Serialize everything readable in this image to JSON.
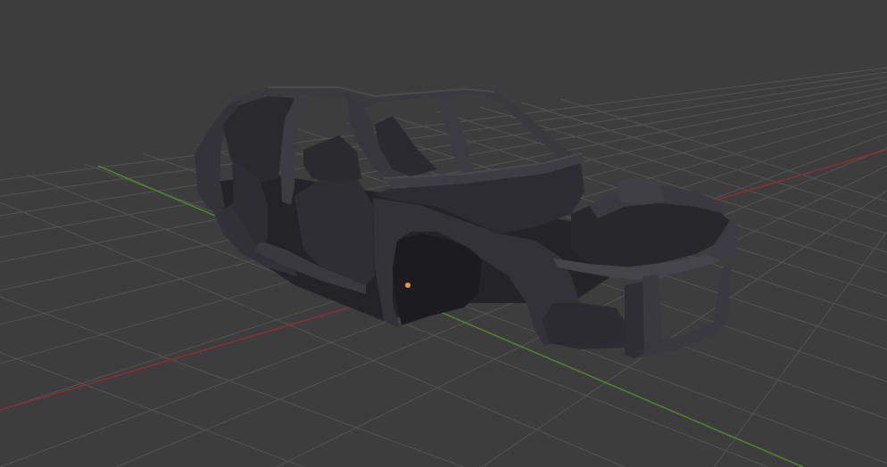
{
  "viewport": {
    "mode": "3d-viewport",
    "background_color": "#3d3d3d",
    "grid_color": "#555555",
    "axis_x_color": "#8a2f33",
    "axis_y_color": "#4a8a2c",
    "origin_color": "#e89a3c"
  },
  "scene": {
    "object": "car-body-shell",
    "object_color": "#2c2b30",
    "selected": false
  }
}
